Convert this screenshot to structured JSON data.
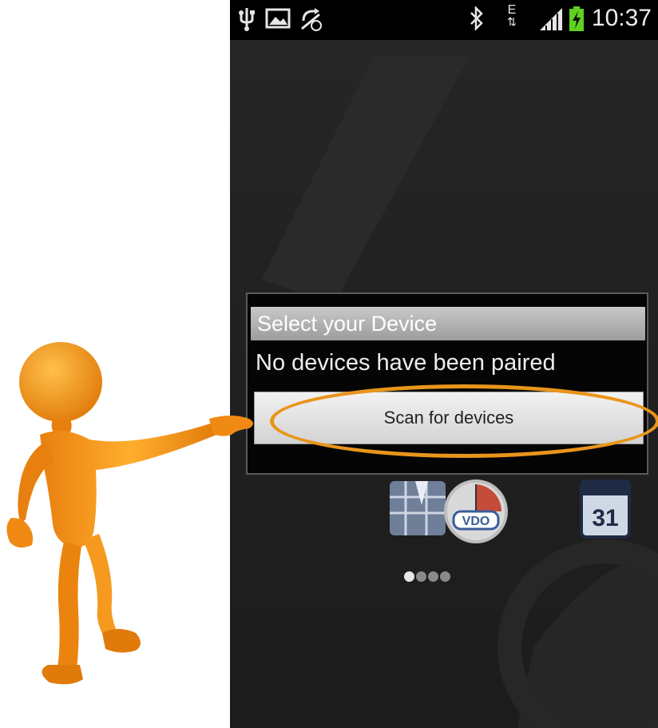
{
  "status_bar": {
    "time": "10:37",
    "network_type": "E",
    "icons": [
      "usb-icon",
      "image-icon",
      "sync-off-icon",
      "bluetooth-icon",
      "network-e-icon",
      "signal-icon",
      "battery-charging-icon"
    ]
  },
  "dialog": {
    "title": "Select your Device",
    "message": "No devices have been paired",
    "scan_button_label": "Scan for devices"
  },
  "app_icons": {
    "vdo_label": "VDO",
    "calendar_label": "31"
  },
  "pager": {
    "total": 4,
    "current": 1
  },
  "colors": {
    "highlight": "#e8951b",
    "figure": "#f08a14",
    "battery": "#5fd21f"
  }
}
